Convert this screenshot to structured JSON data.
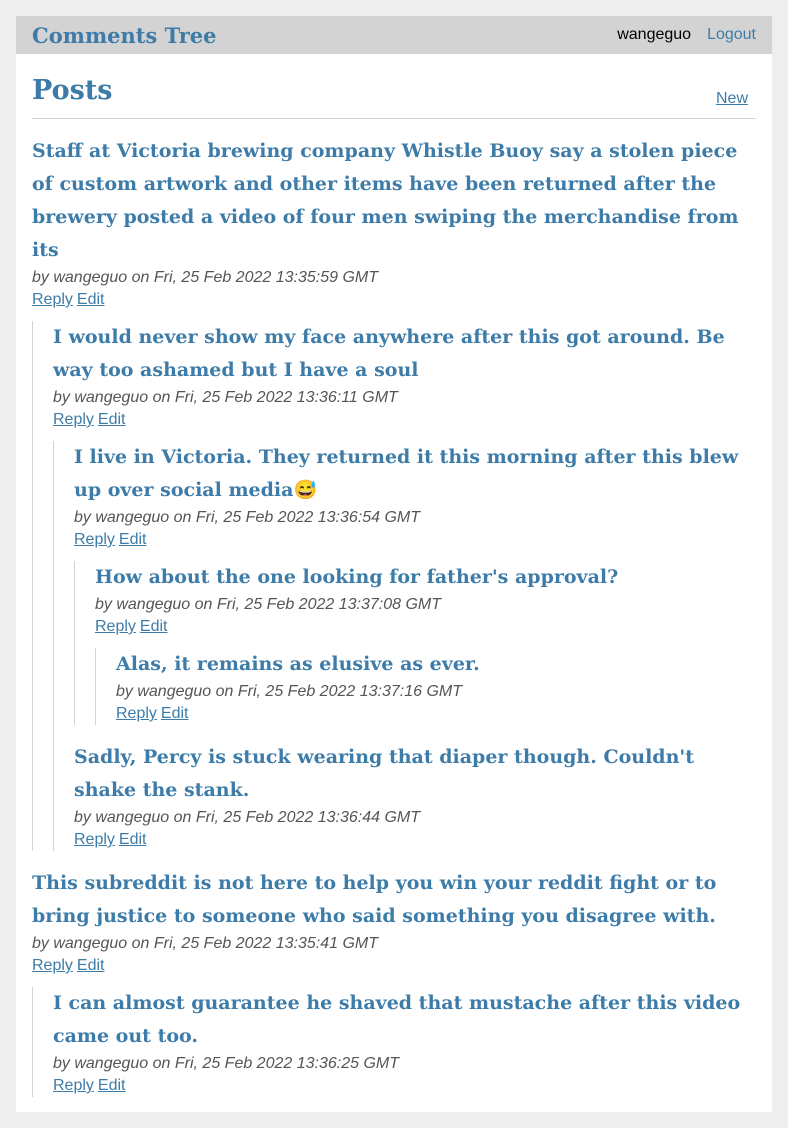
{
  "header": {
    "brand": "Comments Tree",
    "username": "wangeguo",
    "logout_label": "Logout"
  },
  "page": {
    "title": "Posts",
    "new_label": "New"
  },
  "actions": {
    "reply": "Reply",
    "edit": "Edit"
  },
  "comments": [
    {
      "text": "Staff at Victoria brewing company Whistle Buoy say a stolen piece of custom artwork and other items have been returned after the brewery posted a video of four men swiping the merchandise from its",
      "meta": "by wangeguo on Fri, 25 Feb 2022 13:35:59 GMT",
      "children": [
        {
          "text": "I would never show my face anywhere after this got around. Be way too ashamed but I have a soul",
          "meta": "by wangeguo on Fri, 25 Feb 2022 13:36:11 GMT",
          "children": [
            {
              "text": "I live in Victoria. They returned it this morning after this blew up over social media😅",
              "meta": "by wangeguo on Fri, 25 Feb 2022 13:36:54 GMT",
              "children": [
                {
                  "text": "How about the one looking for father's approval?",
                  "meta": "by wangeguo on Fri, 25 Feb 2022 13:37:08 GMT",
                  "children": [
                    {
                      "text": "Alas, it remains as elusive as ever.",
                      "meta": "by wangeguo on Fri, 25 Feb 2022 13:37:16 GMT"
                    }
                  ]
                }
              ]
            },
            {
              "text": "Sadly, Percy is stuck wearing that diaper though. Couldn't shake the stank.",
              "meta": "by wangeguo on Fri, 25 Feb 2022 13:36:44 GMT"
            }
          ]
        }
      ]
    },
    {
      "text": "This subreddit is not here to help you win your reddit fight or to bring justice to someone who said something you disagree with.",
      "meta": "by wangeguo on Fri, 25 Feb 2022 13:35:41 GMT",
      "children": [
        {
          "text": "I can almost guarantee he shaved that mustache after this video came out too.",
          "meta": "by wangeguo on Fri, 25 Feb 2022 13:36:25 GMT"
        }
      ]
    }
  ]
}
